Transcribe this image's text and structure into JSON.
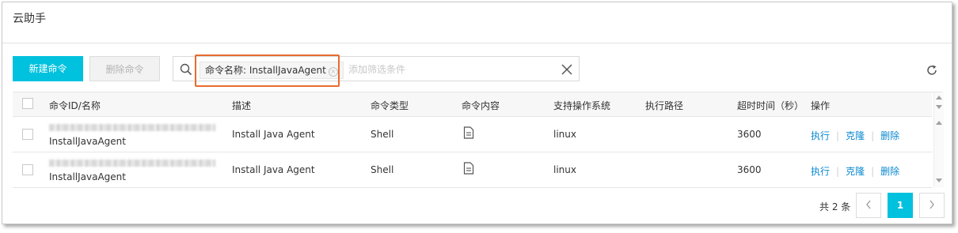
{
  "page": {
    "title": "云助手"
  },
  "toolbar": {
    "new_command": "新建命令",
    "delete_command": "删除命令",
    "filter_tag": "命令名称: InstallJavaAgent",
    "search_placeholder": "添加筛选条件"
  },
  "icons": {
    "search": "search-icon",
    "clear": "close-icon",
    "refresh": "refresh-icon",
    "content": "document-icon"
  },
  "colors": {
    "primary": "#00c1de",
    "link": "#0a89d0",
    "highlight": "#e86b2e"
  },
  "table": {
    "columns": [
      "命令ID/名称",
      "描述",
      "命令类型",
      "命令内容",
      "支持操作系统",
      "执行路径",
      "超时时间（秒）",
      "操作"
    ],
    "rows": [
      {
        "name": "InstallJavaAgent",
        "description": "Install Java Agent",
        "type": "Shell",
        "os": "linux",
        "path": "",
        "timeout": "3600",
        "actions": [
          "执行",
          "克隆",
          "删除"
        ]
      },
      {
        "name": "InstallJavaAgent",
        "description": "Install Java Agent",
        "type": "Shell",
        "os": "linux",
        "path": "",
        "timeout": "3600",
        "actions": [
          "执行",
          "克隆",
          "删除"
        ]
      }
    ]
  },
  "pagination": {
    "total": "共 2 条",
    "current_page": "1"
  }
}
